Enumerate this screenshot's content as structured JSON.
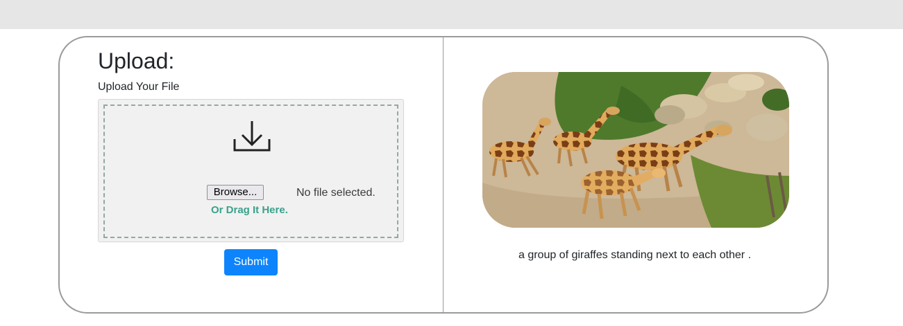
{
  "upload": {
    "title": "Upload:",
    "label": "Upload Your File",
    "browse_label": "Browse...",
    "file_status": "No file selected.",
    "drag_hint": "Or Drag It Here.",
    "submit_label": "Submit"
  },
  "result": {
    "caption": "a group of giraffes standing next to each other ."
  },
  "colors": {
    "topbar": "#e6e6e6",
    "accent_blue": "#0d84fc",
    "drag_hint_green": "#3aa18b",
    "dashed_border": "#92a8a3"
  },
  "icons": {
    "dropzone": "download-icon"
  }
}
